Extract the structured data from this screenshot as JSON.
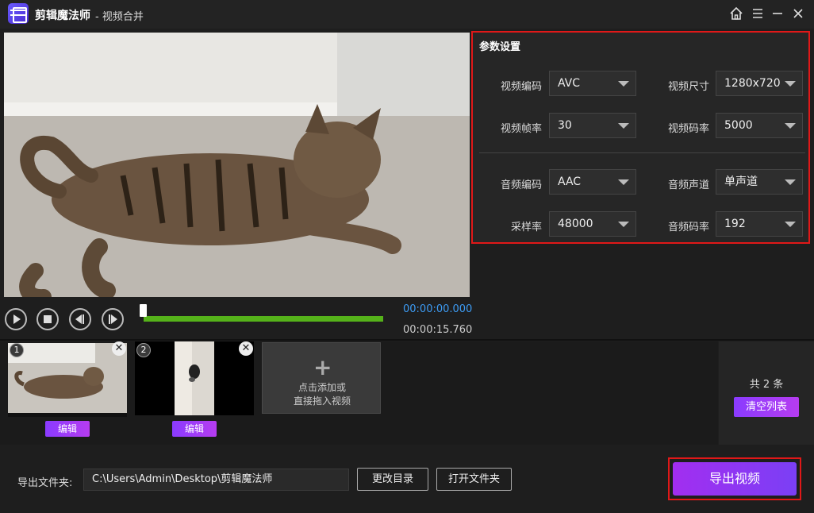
{
  "window": {
    "app_name": "剪辑魔法师",
    "subtitle": "- 视频合并",
    "home_icon": "home-icon",
    "menu_icon": "menu-icon",
    "minimize_icon": "minimize-icon",
    "close_icon": "close-icon"
  },
  "params": {
    "title": "参数设置",
    "video_codec": {
      "label": "视频编码",
      "value": "AVC"
    },
    "video_size": {
      "label": "视频尺寸",
      "value": "1280x720"
    },
    "frame_rate": {
      "label": "视频帧率",
      "value": "30"
    },
    "video_bitrate": {
      "label": "视频码率",
      "value": "5000"
    },
    "audio_codec": {
      "label": "音频编码",
      "value": "AAC"
    },
    "audio_channel": {
      "label": "音频声道",
      "value": "单声道"
    },
    "sample_rate": {
      "label": "采样率",
      "value": "48000"
    },
    "audio_bitrate": {
      "label": "音频码率",
      "value": "192"
    }
  },
  "player": {
    "current_time": "00:00:00.000",
    "total_time": "00:00:15.760",
    "progress": 0.0
  },
  "clips": [
    {
      "index": "1",
      "edit_label": "编辑"
    },
    {
      "index": "2",
      "edit_label": "编辑"
    }
  ],
  "add_box": {
    "line1": "点击添加或",
    "line2": "直接拖入视频"
  },
  "list": {
    "count_text": "共 2 条",
    "clear_label": "清空列表"
  },
  "footer": {
    "output_label": "导出文件夹:",
    "output_path": "C:\\Users\\Admin\\Desktop\\剪辑魔法师",
    "change_dir_label": "更改目录",
    "open_folder_label": "打开文件夹",
    "export_label": "导出视频"
  },
  "colors": {
    "accent_purple": "#8a3bff",
    "highlight_red": "#e01818",
    "progress_green": "#55b21a",
    "time_blue": "#3d9cf5"
  }
}
